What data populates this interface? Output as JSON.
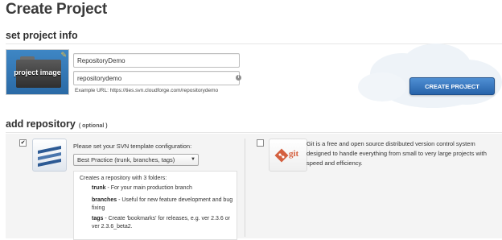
{
  "page": {
    "title": "Create Project"
  },
  "project_info": {
    "heading": "set project info",
    "image_label": "project image",
    "name_value": "RepositoryDemo",
    "url_value": "repositorydemo",
    "example_url": "Example URL: https://ties.svn.cloudforge.com/repositorydemo",
    "create_button": "CREATE PROJECT"
  },
  "repository": {
    "heading": "add repository",
    "optional_label": "( optional )",
    "svn": {
      "checked": true,
      "template_label": "Please set your SVN template configuration:",
      "template_selected": "Best Practice (trunk, branches, tags)",
      "folders_intro": "Creates a repository with 3 folders:",
      "folders": [
        {
          "name": "trunk",
          "desc": " - For your main production branch"
        },
        {
          "name": "branches",
          "desc": " - Useful for new feature development and bug fixing"
        },
        {
          "name": "tags",
          "desc": " - Create 'bookmarks' for releases, e.g. ver 2.3.6 or ver 2.3.6_beta2."
        }
      ]
    },
    "git": {
      "checked": false,
      "logo_text": "git",
      "description": "Git is a free and open source distributed version control system designed to handle everything from small to very large projects with speed and efficiency."
    }
  },
  "colors": {
    "accent_button": "#2f6fb8",
    "git_brand": "#d4603f",
    "svn_brand": "#2d5a94"
  },
  "icons": [
    "pencil-icon",
    "info-icon",
    "svn-logo-icon",
    "git-logo-icon",
    "chevron-down-icon",
    "checkmark-icon"
  ]
}
